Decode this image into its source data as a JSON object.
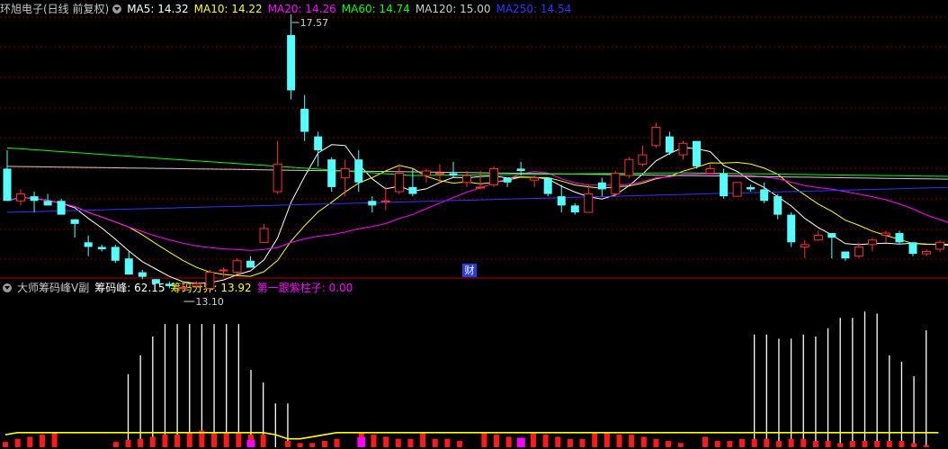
{
  "main_header": {
    "title": "环旭电子(日线 前复权)",
    "ma5": {
      "label": "MA5:",
      "value": "14.32",
      "color": "#ffffff"
    },
    "ma10": {
      "label": "MA10:",
      "value": "14.22",
      "color": "#ffff00"
    },
    "ma20": {
      "label": "MA20:",
      "value": "14.26",
      "color": "#ff00ff"
    },
    "ma60": {
      "label": "MA60:",
      "value": "14.74",
      "color": "#00ff00"
    },
    "ma120": {
      "label": "MA120:",
      "value": "15.00",
      "color": "#cccccc"
    },
    "ma250": {
      "label": "MA250:",
      "value": "14.54",
      "color": "#3333ff"
    }
  },
  "sub_header": {
    "title": "大师筹码峰V副",
    "peak_label": "筹码峰:",
    "peak_value": "62.15",
    "boundary_label": "筹码分界:",
    "boundary_value": "13.92",
    "purple_label": "第一跟紫柱子:",
    "purple_value": "0.00"
  },
  "annotations": {
    "high": "17.57",
    "low": "13.10",
    "badge": "财"
  },
  "colors": {
    "up": "#ff3030",
    "down": "#54ffff",
    "grid": "#7a0000",
    "ma5": "#ffffff",
    "ma10": "#ffff00",
    "ma20": "#ff00ff",
    "ma60": "#00ff00",
    "ma120": "#cccccc",
    "ma250": "#3333ff"
  },
  "chart_data": [
    {
      "type": "candlestick",
      "ylim": [
        12.7,
        18.25
      ],
      "candles": [
        [
          14.9,
          15.3,
          14.2,
          14.2
        ],
        [
          14.2,
          14.45,
          14.1,
          14.35
        ],
        [
          14.3,
          14.4,
          13.95,
          14.2
        ],
        [
          14.2,
          14.35,
          14.1,
          14.1
        ],
        [
          14.2,
          14.25,
          13.9,
          13.9
        ],
        [
          13.8,
          13.8,
          13.4,
          13.7
        ],
        [
          13.3,
          13.45,
          13.0,
          13.2
        ],
        [
          13.2,
          13.25,
          13.1,
          13.15
        ],
        [
          13.2,
          13.25,
          12.85,
          12.9
        ],
        [
          12.95,
          13.1,
          12.6,
          12.6
        ],
        [
          12.65,
          12.7,
          12.5,
          12.55
        ],
        [
          12.5,
          12.5,
          12.4,
          12.4
        ],
        [
          12.4,
          12.45,
          12.3,
          12.35
        ],
        [
          12.32,
          12.38,
          12.25,
          12.32
        ],
        [
          12.35,
          12.45,
          12.3,
          12.4
        ],
        [
          12.3,
          12.7,
          12.3,
          12.65
        ],
        [
          12.7,
          12.75,
          12.55,
          12.7
        ],
        [
          12.65,
          12.95,
          12.6,
          12.9
        ],
        [
          12.9,
          13.0,
          12.75,
          12.75
        ],
        [
          13.3,
          13.7,
          13.3,
          13.6
        ],
        [
          14.4,
          15.5,
          14.35,
          15.0
        ],
        [
          17.8,
          18.25,
          16.4,
          16.6
        ],
        [
          16.2,
          16.5,
          15.5,
          15.7
        ],
        [
          15.6,
          15.7,
          14.95,
          15.3
        ],
        [
          15.1,
          15.15,
          14.4,
          14.5
        ],
        [
          14.7,
          15.1,
          14.3,
          14.9
        ],
        [
          15.1,
          15.3,
          14.4,
          14.6
        ],
        [
          14.2,
          14.3,
          13.95,
          14.1
        ],
        [
          14.2,
          14.5,
          14.0,
          14.2
        ],
        [
          14.4,
          15.0,
          14.35,
          14.8
        ],
        [
          14.5,
          14.9,
          14.3,
          14.35
        ],
        [
          14.75,
          14.9,
          14.6,
          14.85
        ],
        [
          14.8,
          15.0,
          14.6,
          14.8
        ],
        [
          14.8,
          15.05,
          14.7,
          14.75
        ],
        [
          14.6,
          14.85,
          14.5,
          14.75
        ],
        [
          14.5,
          14.85,
          14.45,
          14.5
        ],
        [
          14.55,
          14.95,
          14.5,
          14.9
        ],
        [
          14.7,
          14.7,
          14.5,
          14.6
        ],
        [
          14.9,
          15.05,
          14.75,
          14.85
        ],
        [
          14.65,
          14.75,
          14.5,
          14.7
        ],
        [
          14.7,
          14.7,
          14.3,
          14.35
        ],
        [
          14.3,
          14.55,
          13.95,
          14.1
        ],
        [
          14.1,
          14.15,
          13.9,
          13.95
        ],
        [
          13.95,
          14.55,
          13.95,
          14.35
        ],
        [
          14.6,
          14.7,
          14.3,
          14.45
        ],
        [
          14.35,
          14.85,
          14.3,
          14.8
        ],
        [
          14.75,
          15.15,
          14.7,
          15.1
        ],
        [
          15.0,
          15.4,
          14.95,
          15.2
        ],
        [
          15.4,
          15.9,
          15.35,
          15.8
        ],
        [
          15.6,
          15.7,
          15.2,
          15.25
        ],
        [
          15.2,
          15.5,
          15.1,
          15.45
        ],
        [
          15.5,
          15.5,
          14.9,
          14.95
        ],
        [
          14.8,
          15.0,
          14.85,
          14.9
        ],
        [
          14.8,
          14.9,
          14.25,
          14.3
        ],
        [
          14.3,
          14.6,
          14.3,
          14.6
        ],
        [
          14.5,
          14.55,
          14.4,
          14.45
        ],
        [
          14.45,
          14.6,
          14.15,
          14.2
        ],
        [
          14.3,
          14.35,
          13.8,
          13.9
        ],
        [
          13.9,
          13.95,
          13.2,
          13.3
        ],
        [
          13.2,
          13.35,
          12.95,
          13.25
        ],
        [
          13.35,
          13.55,
          13.35,
          13.45
        ],
        [
          13.5,
          13.5,
          12.95,
          13.4
        ],
        [
          13.1,
          13.1,
          12.9,
          12.95
        ],
        [
          13.0,
          13.3,
          12.95,
          13.2
        ],
        [
          13.25,
          13.4,
          13.1,
          13.35
        ],
        [
          13.45,
          13.55,
          13.3,
          13.5
        ],
        [
          13.5,
          13.55,
          13.25,
          13.3
        ],
        [
          13.3,
          13.3,
          13.0,
          13.05
        ],
        [
          13.05,
          13.15,
          13.0,
          13.1
        ],
        [
          13.15,
          13.35,
          13.1,
          13.3
        ],
        [
          13.3,
          13.5,
          13.2,
          13.4
        ],
        [
          13.45,
          13.6,
          13.35,
          13.55
        ],
        [
          13.55,
          13.9,
          13.4,
          13.85
        ],
        [
          13.8,
          13.85,
          13.65,
          13.7
        ],
        [
          13.6,
          13.65,
          13.5,
          13.55
        ],
        [
          13.5,
          13.55,
          13.3,
          13.3
        ],
        [
          13.25,
          13.35,
          13.2,
          13.3
        ]
      ]
    },
    {
      "type": "bar",
      "ylim": [
        0,
        72
      ],
      "white_values": [
        0,
        0,
        0,
        0,
        0,
        0,
        0,
        0,
        0,
        0,
        35,
        44,
        53,
        59,
        59,
        59,
        59,
        59,
        59,
        59,
        37,
        31,
        21,
        21,
        0,
        0,
        0,
        0,
        0,
        0,
        0,
        0,
        0,
        0,
        0,
        0,
        0,
        0,
        0,
        0,
        0,
        0,
        0,
        0,
        0,
        0,
        0,
        0,
        0,
        0,
        0,
        0,
        0,
        0,
        0,
        0,
        0,
        0,
        0,
        0,
        0,
        54,
        54,
        52,
        52,
        54,
        53,
        57,
        62,
        62,
        65,
        64,
        44,
        41,
        34,
        56
      ],
      "red_values": [
        2.5,
        4,
        5,
        6,
        7,
        0,
        0,
        0,
        0,
        2.5,
        3.5,
        4,
        5,
        6,
        6,
        7,
        8,
        7,
        7,
        7,
        6,
        6,
        0,
        3,
        2,
        2,
        3,
        4,
        0,
        7,
        6,
        5,
        4,
        4,
        7,
        4,
        4,
        3,
        0,
        7,
        6,
        5,
        0,
        7,
        6,
        5,
        4,
        4,
        7,
        7,
        6,
        6,
        5,
        4,
        3,
        2,
        0,
        5,
        3,
        3,
        4,
        4,
        4,
        3,
        4,
        4,
        3,
        3,
        2,
        3,
        3,
        3,
        3,
        3,
        2,
        1
      ],
      "magenta_values": [
        0,
        0,
        0,
        0,
        0,
        0,
        0,
        0,
        0,
        0,
        0,
        0,
        0,
        0,
        0,
        0,
        0,
        0,
        0,
        0,
        0,
        0,
        3,
        0,
        0,
        0,
        0,
        0,
        0,
        0,
        0,
        0,
        0,
        0,
        0,
        0,
        0,
        0,
        0,
        0,
        0,
        0,
        0,
        0,
        0,
        0,
        0,
        0,
        0,
        0,
        0,
        0,
        0,
        0,
        0,
        0,
        0,
        0,
        0,
        0,
        0,
        0,
        0,
        0,
        0,
        0,
        0,
        0,
        0,
        0,
        0,
        0,
        0,
        0,
        0,
        0
      ],
      "line_values": [
        6,
        7,
        7,
        7,
        7,
        7,
        7,
        7,
        7,
        7,
        7,
        7,
        7,
        7,
        7,
        7,
        7,
        7,
        7,
        7,
        7,
        7,
        6,
        4,
        4,
        5,
        6,
        7,
        7,
        7,
        7,
        7,
        7,
        7,
        7,
        7,
        7,
        7,
        7,
        7,
        7,
        7,
        7,
        7,
        7,
        7,
        7,
        7,
        7,
        7,
        7,
        7,
        7,
        7,
        7,
        7,
        7,
        7,
        7,
        7,
        7,
        7,
        7,
        7,
        7,
        7,
        7,
        7,
        7,
        7,
        7,
        7,
        7,
        7,
        7,
        7,
        7
      ]
    }
  ]
}
